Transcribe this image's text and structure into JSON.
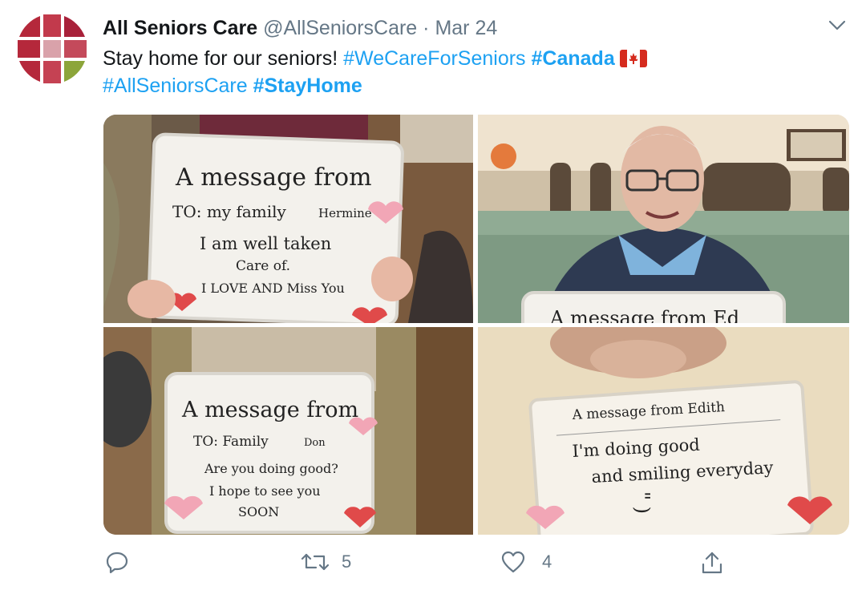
{
  "tweet": {
    "author_name": "All Seniors Care",
    "handle": "@AllSeniorsCare",
    "separator": "·",
    "date": "Mar 24",
    "text_plain": "Stay home for our seniors!",
    "hashtag_1": "#WeCareForSeniors",
    "hashtag_2": "#Canada",
    "hashtag_3": "#AllSeniorsCare",
    "hashtag_4": "#StayHome"
  },
  "media": {
    "photos": [
      {
        "board_lines": [
          "A message from",
          "TO: my family",
          "Hermine",
          "I am well taken",
          "Care of.",
          "I LOVE AND Miss You"
        ]
      },
      {
        "board_lines": [
          "A message from Ed"
        ]
      },
      {
        "board_lines": [
          "A message from",
          "TO: Family",
          "Don",
          "Are you doing good?",
          "I hope to see you",
          "SOON"
        ]
      },
      {
        "board_lines": [
          "A message from Edith",
          "I'm doing good",
          "and smiling everyday",
          "\" )"
        ]
      }
    ]
  },
  "actions": {
    "reply_count": "",
    "retweet_count": "5",
    "like_count": "4"
  },
  "icons": {
    "reply": "reply-icon",
    "retweet": "retweet-icon",
    "like": "heart-icon",
    "share": "share-icon",
    "caret": "chevron-down-icon"
  },
  "colors": {
    "link": "#1da1f2",
    "muted": "#657786",
    "logo_red": "#b5283b",
    "logo_green": "#8ca53a"
  }
}
